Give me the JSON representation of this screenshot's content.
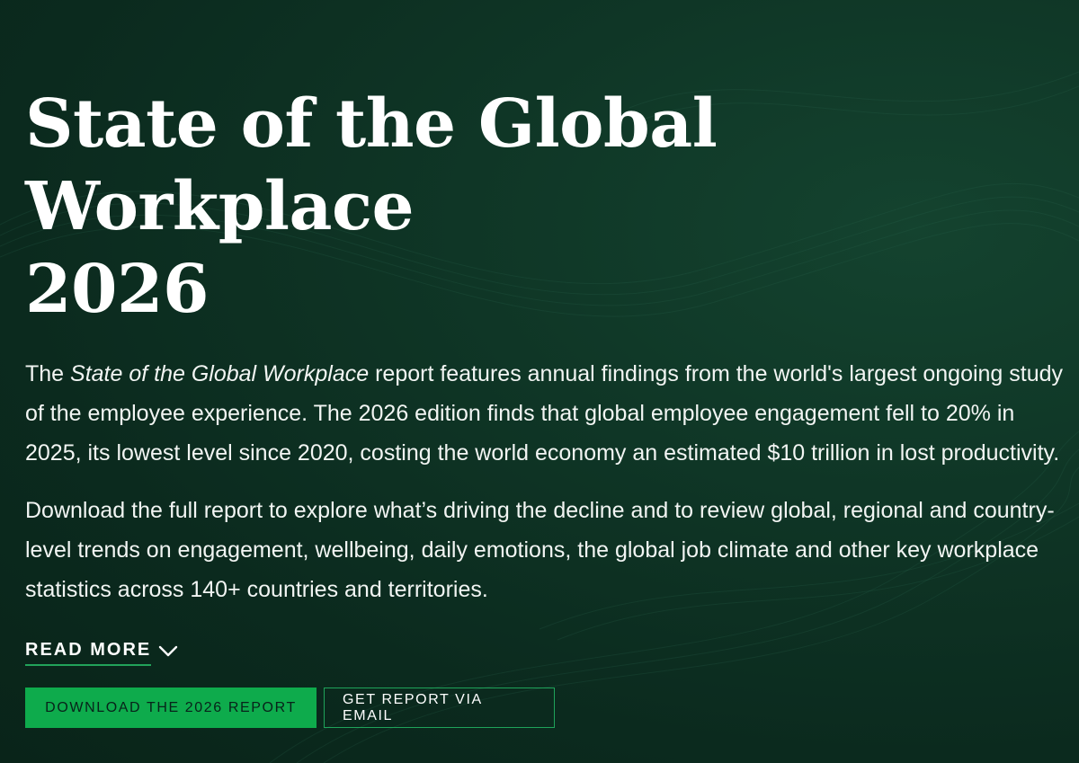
{
  "hero": {
    "title_line1": "State of the Global Workplace",
    "title_line2": "2026",
    "para1": {
      "prefix": "The ",
      "emphasis": "State of the Global Workplace",
      "suffix": " report features annual findings from the world's largest ongoing study of the employee experience. The 2026 edition finds that global employee engagement fell to 20% in 2025, its lowest level since 2020, costing the world economy an estimated $10 trillion in lost productivity."
    },
    "para2": "Download the full report to explore what’s driving the decline and to review global, regional and country-level trends on engagement, wellbeing, daily emotions, the global job climate and other key workplace statistics across 140+ countries and territories.",
    "read_more_label": "READ MORE",
    "download_button_label": "DOWNLOAD THE 2026 REPORT",
    "email_button_label": "GET REPORT VIA EMAIL"
  },
  "colors": {
    "background": "#0f3626",
    "accent_green": "#0eab4c",
    "underline_green": "#22a35a"
  },
  "icons": {
    "read_more": "chevron-down-icon"
  }
}
